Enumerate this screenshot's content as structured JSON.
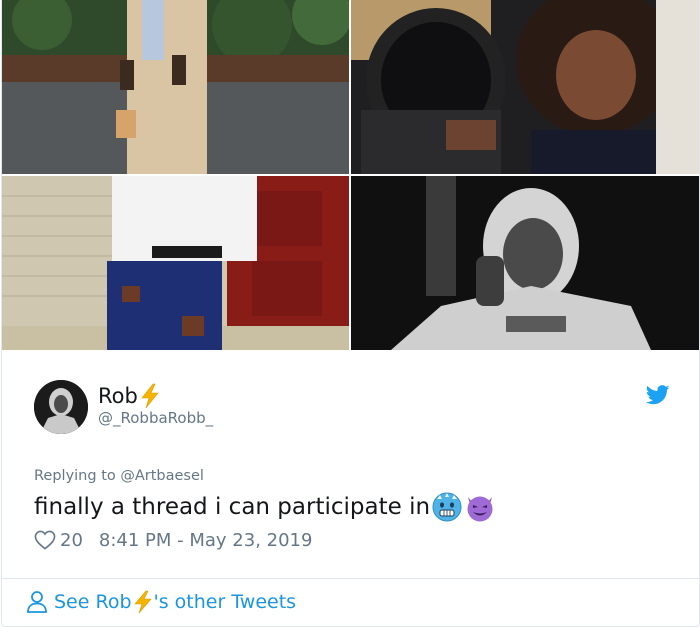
{
  "media": [
    {
      "name": "photo-1",
      "alt": ""
    },
    {
      "name": "photo-2",
      "alt": ""
    },
    {
      "name": "photo-3",
      "alt": ""
    },
    {
      "name": "photo-4",
      "alt": ""
    }
  ],
  "author": {
    "display_name": "Rob",
    "handle": "@_RobbaRobb_",
    "name_emoji": "high-voltage-emoji"
  },
  "tweet": {
    "reply_context": "Replying to @Artbaesel",
    "text": "finally a thread i can participate in",
    "emojis": [
      "cold-face-emoji",
      "smiling-imp-emoji"
    ],
    "like_count": "20",
    "timestamp": "8:41 PM - May 23, 2019"
  },
  "footer": {
    "see_more_prefix": "See Rob",
    "see_more_suffix": "'s other Tweets"
  },
  "colors": {
    "twitter_blue": "#1da1f2",
    "link_blue": "#1b95e0",
    "text": "#14171a",
    "muted": "#657786",
    "border": "#e1e8ed"
  }
}
